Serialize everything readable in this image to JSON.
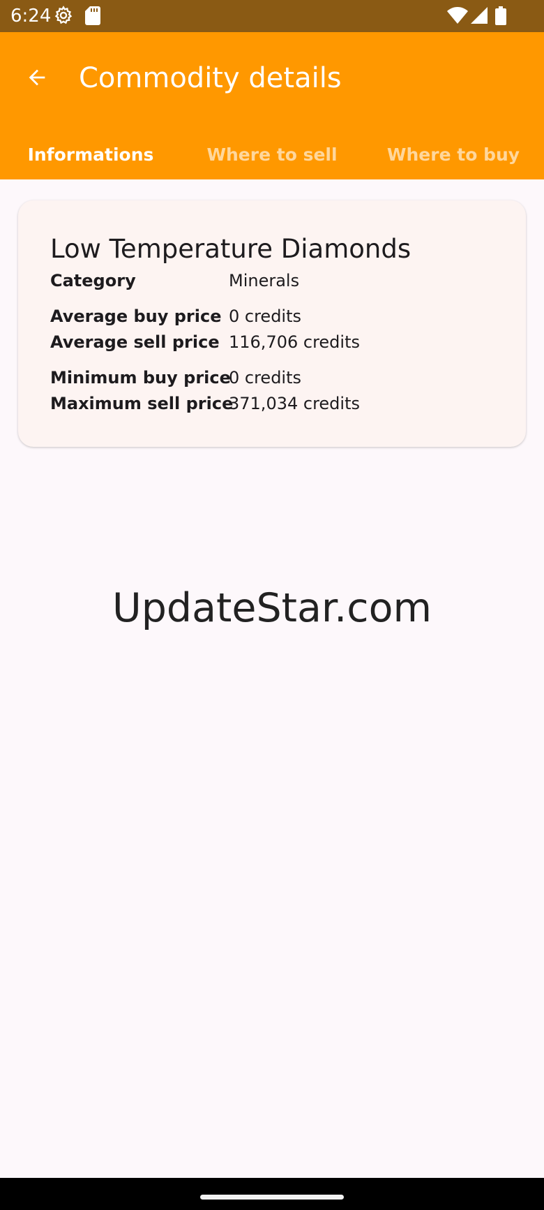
{
  "status_bar": {
    "time": "6:24",
    "icons": [
      "gear-icon",
      "sd-card-icon",
      "wifi-icon",
      "signal-icon",
      "battery-icon"
    ]
  },
  "app_bar": {
    "title": "Commodity details",
    "back_icon": "arrow-back-icon",
    "background_color": "#ff9800",
    "tabs": [
      {
        "label": "Informations",
        "active": true
      },
      {
        "label": "Where to sell",
        "active": false
      },
      {
        "label": "Where to buy",
        "active": false
      }
    ]
  },
  "commodity": {
    "name": "Low Temperature Diamonds",
    "rows": {
      "category": {
        "label": "Category",
        "value": "Minerals"
      },
      "avg_buy": {
        "label": "Average buy price",
        "value": "0 credits"
      },
      "avg_sell": {
        "label": "Average sell price",
        "value": "116,706 credits"
      },
      "min_buy": {
        "label": "Minimum buy price",
        "value": "0 credits"
      },
      "max_sell": {
        "label": "Maximum sell price",
        "value": "371,034 credits"
      }
    }
  },
  "watermark": "UpdateStar.com"
}
